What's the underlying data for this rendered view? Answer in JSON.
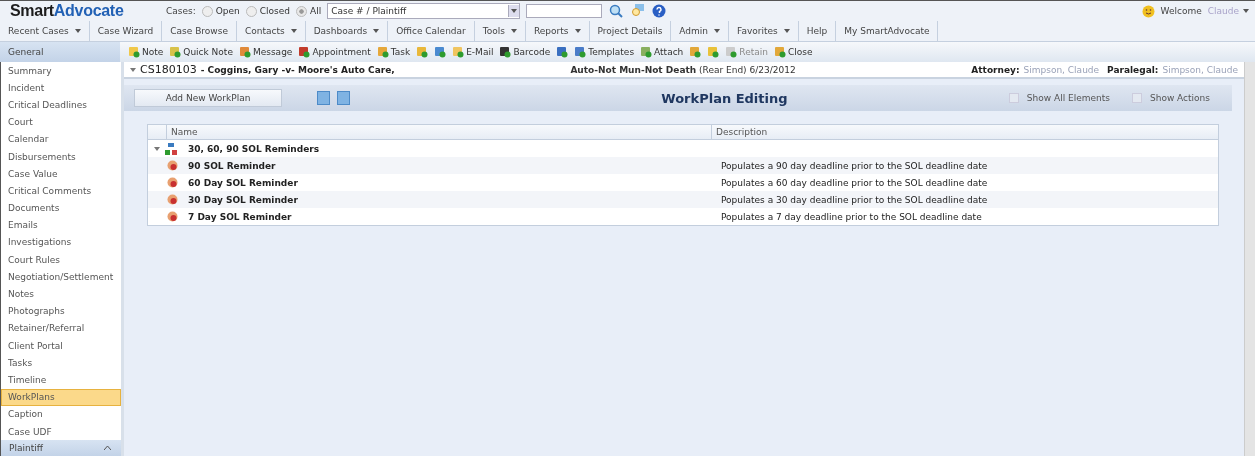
{
  "header": {
    "logo_first": "Smart",
    "logo_second": "Advocate",
    "cases_label": "Cases:",
    "case_filters": [
      {
        "label": "Open",
        "selected": false
      },
      {
        "label": "Closed",
        "selected": false
      },
      {
        "label": "All",
        "selected": true
      }
    ],
    "case_select": {
      "value": "Case # / Plaintiff"
    },
    "welcome": "Welcome",
    "user": "Claude"
  },
  "menu": [
    {
      "label": "Recent Cases",
      "dropdown": true
    },
    {
      "label": "Case Wizard",
      "dropdown": false
    },
    {
      "label": "Case Browse",
      "dropdown": false
    },
    {
      "label": "Contacts",
      "dropdown": true
    },
    {
      "label": "Dashboards",
      "dropdown": true
    },
    {
      "label": "Office Calendar",
      "dropdown": false
    },
    {
      "label": "Tools",
      "dropdown": true
    },
    {
      "label": "Reports",
      "dropdown": true
    },
    {
      "label": "Project Details",
      "dropdown": false
    },
    {
      "label": "Admin",
      "dropdown": true
    },
    {
      "label": "Favorites",
      "dropdown": true
    },
    {
      "label": "Help",
      "dropdown": false
    },
    {
      "label": "My SmartAdvocate",
      "dropdown": false
    }
  ],
  "toolbar": [
    {
      "label": "Note",
      "disabled": false
    },
    {
      "label": "Quick Note",
      "disabled": false
    },
    {
      "label": "Message",
      "disabled": false
    },
    {
      "label": "Appointment",
      "disabled": false
    },
    {
      "label": "Task",
      "disabled": false
    },
    {
      "disabled": false
    },
    {
      "disabled": false
    },
    {
      "label": "E-Mail",
      "disabled": false
    },
    {
      "label": "Barcode",
      "disabled": false
    },
    {
      "disabled": false
    },
    {
      "label": "Templates",
      "disabled": false
    },
    {
      "label": "Attach",
      "disabled": false
    },
    {
      "disabled": false
    },
    {
      "disabled": false
    },
    {
      "label": "Retain",
      "disabled": true
    },
    {
      "label": "Close",
      "disabled": false
    }
  ],
  "sidebar": {
    "section": "General",
    "items": [
      {
        "label": "Summary",
        "selected": false
      },
      {
        "label": "Incident",
        "selected": false
      },
      {
        "label": "Critical Deadlines",
        "selected": false
      },
      {
        "label": "Court",
        "selected": false
      },
      {
        "label": "Calendar",
        "selected": false
      },
      {
        "label": "Disbursements",
        "selected": false
      },
      {
        "label": "Case Value",
        "selected": false
      },
      {
        "label": "Critical Comments",
        "selected": false
      },
      {
        "label": "Documents",
        "selected": false
      },
      {
        "label": "Emails",
        "selected": false
      },
      {
        "label": "Investigations",
        "selected": false
      },
      {
        "label": "Court Rules",
        "selected": false
      },
      {
        "label": "Negotiation/Settlement",
        "selected": false
      },
      {
        "label": "Notes",
        "selected": false
      },
      {
        "label": "Photographs",
        "selected": false
      },
      {
        "label": "Retainer/Referral",
        "selected": false
      },
      {
        "label": "Client Portal",
        "selected": false
      },
      {
        "label": "Tasks",
        "selected": false
      },
      {
        "label": "Timeline",
        "selected": false
      },
      {
        "label": "WorkPlans",
        "selected": true
      },
      {
        "label": "Caption",
        "selected": false
      },
      {
        "label": "Case UDF",
        "selected": false
      }
    ],
    "bottom_section": "Plaintiff"
  },
  "case_bar": {
    "case_number": "CS180103",
    "parties": "- Coggins, Gary -v- Moore's Auto Care,",
    "case_type": "**Auto-Not Mun-Not Death** (Rear End) 6/23/2012",
    "attorney_label": "Attorney:",
    "attorney": "Simpson, Claude",
    "paralegal_label": "Paralegal:",
    "paralegal": "Simpson, Claude"
  },
  "workplan": {
    "add_button": "Add New WorkPlan",
    "title": "WorkPlan Editing",
    "options": [
      {
        "label": "Show All Elements",
        "checked": false
      },
      {
        "label": "Show Actions",
        "checked": false
      }
    ]
  },
  "grid": {
    "columns": [
      "Name",
      "Description"
    ],
    "groups": [
      {
        "name": "30, 60, 90 SOL Reminders",
        "expanded": true,
        "children": [
          {
            "name": "90 SOL Reminder",
            "description": "Populates a 90 day deadline prior to the SOL deadline date"
          },
          {
            "name": "60 Day SOL Reminder",
            "description": "Populates a 60 day deadline prior to the SOL deadline date"
          },
          {
            "name": "30 Day SOL Reminder",
            "description": "Populates a 30 day deadline prior to the SOL deadline date"
          },
          {
            "name": "7 Day SOL Reminder",
            "description": "Populates a 7 day deadline prior to the SOL deadline date"
          }
        ]
      }
    ]
  }
}
